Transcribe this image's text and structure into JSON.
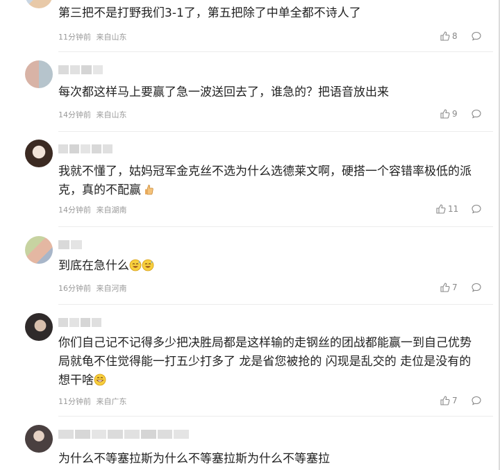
{
  "comments": [
    {
      "text": "第三把不是打野我们3-1了，第五把除了中单全都不诗人了",
      "time": "11分钟前",
      "location": "来自山东",
      "likes": "8"
    },
    {
      "text": "每次都这样马上要赢了急一波送回去了，谁急的？把语音放出来",
      "time": "14分钟前",
      "location": "来自山东",
      "likes": "9"
    },
    {
      "text": "我就不懂了，姑妈冠军金克丝不选为什么选德莱文啊，硬搭一个容错率极低的派克，真的不配赢",
      "time": "14分钟前",
      "location": "来自湖南",
      "likes": "11"
    },
    {
      "text": "到底在急什么",
      "time": "16分钟前",
      "location": "来自河南",
      "likes": "7"
    },
    {
      "text": "你们自己记不记得多少把决胜局都是这样输的走钢丝的团战都能赢一到自己优势局就龟不住觉得能一打五少打多了 龙是省您被抢的 闪现是乱交的 走位是没有的 想干啥",
      "time": "11分钟前",
      "location": "来自广东",
      "likes": "7"
    },
    {
      "text": "为什么不等塞拉斯为什么不等塞拉斯为什么不等塞拉"
    }
  ],
  "colors": {
    "text": "#222222",
    "meta": "#999999",
    "divider": "#ececec"
  },
  "icons": [
    "thumbs-up-icon",
    "reply-bubble-icon",
    "thumbs-up-emoji-icon",
    "sweat-smile-emoji-icon",
    "grin-emoji-icon"
  ]
}
